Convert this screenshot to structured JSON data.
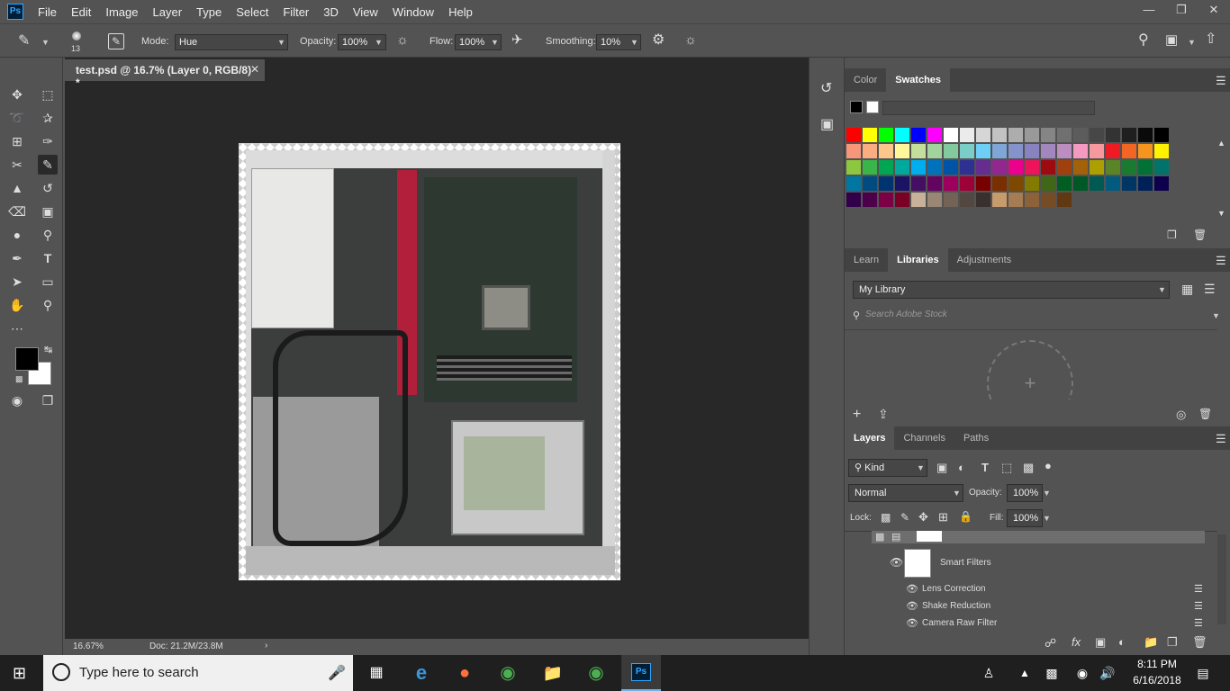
{
  "app": {
    "logo": "Ps"
  },
  "menu": [
    "File",
    "Edit",
    "Image",
    "Layer",
    "Type",
    "Select",
    "Filter",
    "3D",
    "View",
    "Window",
    "Help"
  ],
  "options": {
    "brush_size": "13",
    "mode_label": "Mode:",
    "mode_value": "Hue",
    "opacity_label": "Opacity:",
    "opacity_value": "100%",
    "flow_label": "Flow:",
    "flow_value": "100%",
    "smoothing_label": "Smoothing:",
    "smoothing_value": "10%"
  },
  "document": {
    "tab_title": "test.psd @ 16.7% (Layer 0, RGB/8) *",
    "zoom": "16.67%",
    "doc_size": "Doc: 21.2M/23.8M"
  },
  "color_panel": {
    "tabs": [
      "Color",
      "Swatches"
    ],
    "active": "Swatches"
  },
  "swatches": [
    [
      "#ff0000",
      "#ffff00",
      "#00ff00",
      "#00ffff",
      "#0000ff",
      "#ff00ff",
      "#ffffff",
      "#ebebeb",
      "#d6d6d6",
      "#c2c2c2",
      "#adadad",
      "#999999",
      "#858585",
      "#707070",
      "#5c5c5c",
      "#474747",
      "#333333",
      "#1f1f1f",
      "#0a0a0a",
      "#000000"
    ],
    [
      "#f7977a",
      "#f9ad81",
      "#fdc68a",
      "#fff79a",
      "#c4df9b",
      "#a3d39c",
      "#82ca9d",
      "#7bcdc8",
      "#6ecff6",
      "#7ea7d8",
      "#8493ca",
      "#8882be",
      "#a187be",
      "#bc8dbf",
      "#f49ac2",
      "#f6989d",
      "#ed1c24",
      "#f26522",
      "#f7941d",
      "#fff200"
    ],
    [
      "#8dc73f",
      "#39b54a",
      "#00a651",
      "#00a99d",
      "#00aeef",
      "#0072bc",
      "#0054a6",
      "#2e3192",
      "#662d91",
      "#92278f",
      "#ec008c",
      "#ed145b",
      "#9e0b0f",
      "#a0410d",
      "#a36209",
      "#aba000",
      "#598527",
      "#197b30",
      "#007236",
      "#00746b"
    ],
    [
      "#0076a3",
      "#004b80",
      "#003471",
      "#1b1464",
      "#440e62",
      "#630460",
      "#9e005d",
      "#9e0039",
      "#790000",
      "#7b2e00",
      "#7d4900",
      "#827b00",
      "#406618",
      "#005e20",
      "#005826",
      "#005952",
      "#005b7f",
      "#003663",
      "#002157",
      "#0d004c"
    ],
    [
      "#32004b",
      "#4b0049",
      "#7b0046",
      "#7a0026",
      "#c7b299",
      "#998675",
      "#736357",
      "#534741",
      "#37302d",
      "#c69c6d",
      "#a67c52",
      "#8c6239",
      "#754c24",
      "#603913"
    ]
  ],
  "libraries_panel": {
    "tabs": [
      "Learn",
      "Libraries",
      "Adjustments"
    ],
    "active": "Libraries",
    "library": "My Library",
    "search_placeholder": "Search Adobe Stock"
  },
  "layers_panel": {
    "tabs": [
      "Layers",
      "Channels",
      "Paths"
    ],
    "active": "Layers",
    "kind": "Kind",
    "blend": "Normal",
    "opacity_label": "Opacity:",
    "opacity_value": "100%",
    "lock_label": "Lock:",
    "fill_label": "Fill:",
    "fill_value": "100%",
    "smart_filters": "Smart Filters",
    "filters": [
      "Lens Correction",
      "Shake Reduction",
      "Camera Raw Filter"
    ]
  },
  "taskbar": {
    "search_placeholder": "Type here to search",
    "time": "8:11 PM",
    "date": "6/16/2018"
  }
}
